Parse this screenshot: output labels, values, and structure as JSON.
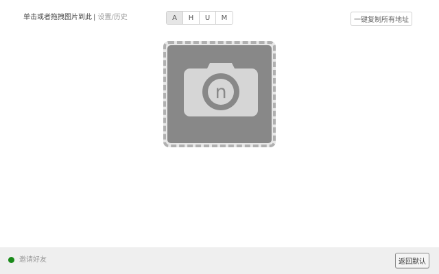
{
  "header": {
    "hint_text": "单击或者拖拽图片到此",
    "separator": "|",
    "settings_link": "设置/历史",
    "copy_all_label": "一键复制所有地址"
  },
  "formats": {
    "options": [
      "A",
      "H",
      "U",
      "M"
    ],
    "selected": "A"
  },
  "dropzone": {
    "icon": "camera-icon",
    "icon_letter": "n"
  },
  "footer": {
    "status_color": "#1a8a1a",
    "invite_label": "邀请好友",
    "reset_label": "返回默认"
  }
}
